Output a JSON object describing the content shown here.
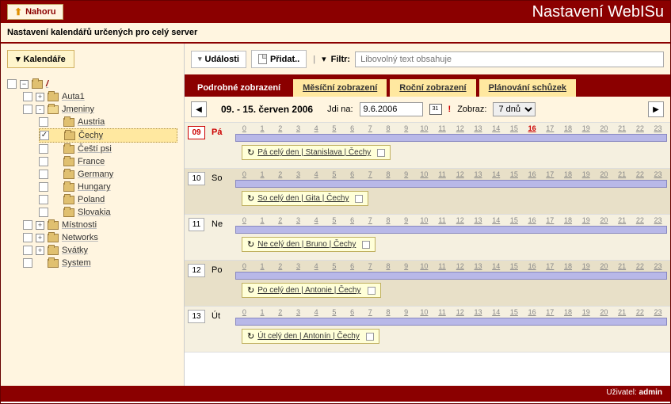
{
  "header": {
    "nahoru": "Nahoru",
    "title": "Nastavení WebISu"
  },
  "subheader": "Nastavení kalendářů určených pro celý server",
  "sidebar": {
    "button": "Kalendáře",
    "root": "/",
    "items": [
      {
        "label": "Auta1",
        "expand": "+"
      },
      {
        "label": "Jmeniny",
        "expand": "-",
        "open": true,
        "children": [
          {
            "label": "Austria"
          },
          {
            "label": "Čechy",
            "selected": true,
            "checked": true
          },
          {
            "label": "Čeští psi"
          },
          {
            "label": "France"
          },
          {
            "label": "Germany"
          },
          {
            "label": "Hungary"
          },
          {
            "label": "Poland"
          },
          {
            "label": "Slovakia"
          }
        ]
      },
      {
        "label": "Místnosti",
        "expand": "+"
      },
      {
        "label": "Networks",
        "expand": "+"
      },
      {
        "label": "Svátky",
        "expand": "+"
      },
      {
        "label": "System"
      }
    ]
  },
  "toolbar": {
    "udalosti": "Události",
    "pridat": "Přidat..",
    "filtr_label": "Filtr:",
    "filtr_placeholder": "Libovolný text obsahuje"
  },
  "tabs": [
    {
      "label": "Podrobné zobrazení",
      "active": true
    },
    {
      "label": "Měsíční zobrazení"
    },
    {
      "label": "Roční zobrazení"
    },
    {
      "label": "Plánování schůzek"
    }
  ],
  "nav": {
    "range": "09. - 15. červen 2006",
    "jdi_na": "Jdi na:",
    "date_value": "9.6.2006",
    "zobraz": "Zobraz:",
    "zobraz_value": "7 dnů"
  },
  "hours": [
    "0",
    "1",
    "2",
    "3",
    "4",
    "5",
    "6",
    "7",
    "8",
    "9",
    "10",
    "11",
    "12",
    "13",
    "14",
    "15",
    "16",
    "17",
    "18",
    "19",
    "20",
    "21",
    "22",
    "23"
  ],
  "days": [
    {
      "num": "09",
      "abbr": "Pá",
      "today": true,
      "event": "Pá celý den | Stanislava | Čechy",
      "hot": "16"
    },
    {
      "num": "10",
      "abbr": "So",
      "event": "So celý den | Gita | Čechy"
    },
    {
      "num": "11",
      "abbr": "Ne",
      "event": "Ne celý den | Bruno | Čechy"
    },
    {
      "num": "12",
      "abbr": "Po",
      "event": "Po celý den | Antonie | Čechy"
    },
    {
      "num": "13",
      "abbr": "Út",
      "event": "Út celý den | Antonín | Čechy"
    }
  ],
  "footer": {
    "user_label": "Uživatel:",
    "user": "admin"
  }
}
